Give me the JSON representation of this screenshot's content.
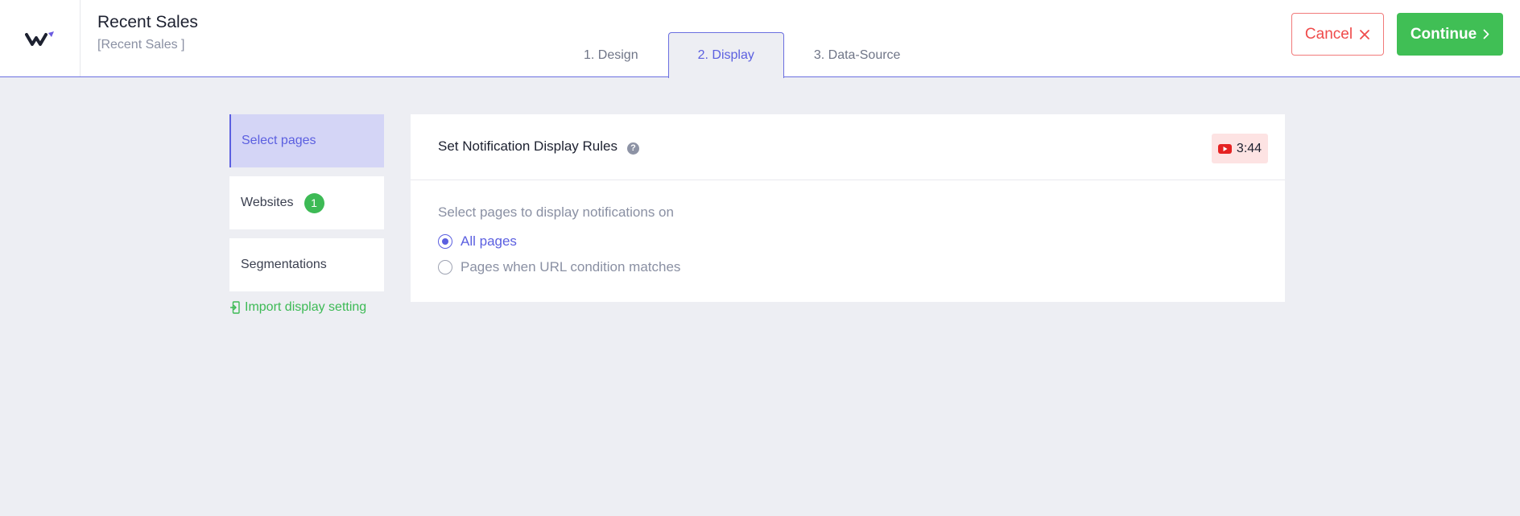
{
  "header": {
    "title": "Recent Sales",
    "subtitle": "[Recent Sales ]",
    "tabs": [
      {
        "label": "1. Design"
      },
      {
        "label": "2. Display"
      },
      {
        "label": "3. Data-Source"
      }
    ],
    "active_tab": "2. Display",
    "cancel_label": "Cancel",
    "continue_label": "Continue"
  },
  "sidebar": {
    "items": [
      {
        "label": "Select pages"
      },
      {
        "label": "Websites",
        "badge": "1"
      },
      {
        "label": "Segmentations"
      }
    ],
    "import_label": "Import display setting"
  },
  "panel": {
    "title": "Set Notification Display Rules",
    "help_glyph": "?",
    "video_duration": "3:44",
    "section_label": "Select pages to display notifications on",
    "options": [
      {
        "label": "All pages",
        "selected": true
      },
      {
        "label": "Pages when URL condition matches",
        "selected": false
      }
    ]
  },
  "colors": {
    "accent": "#5b5fe0",
    "success": "#40bf55",
    "danger": "#ef4b4b",
    "background": "#edeef3"
  },
  "icons": [
    "brand-logo-icon",
    "close-icon",
    "chevron-right-icon",
    "help-icon",
    "youtube-icon",
    "import-icon"
  ]
}
